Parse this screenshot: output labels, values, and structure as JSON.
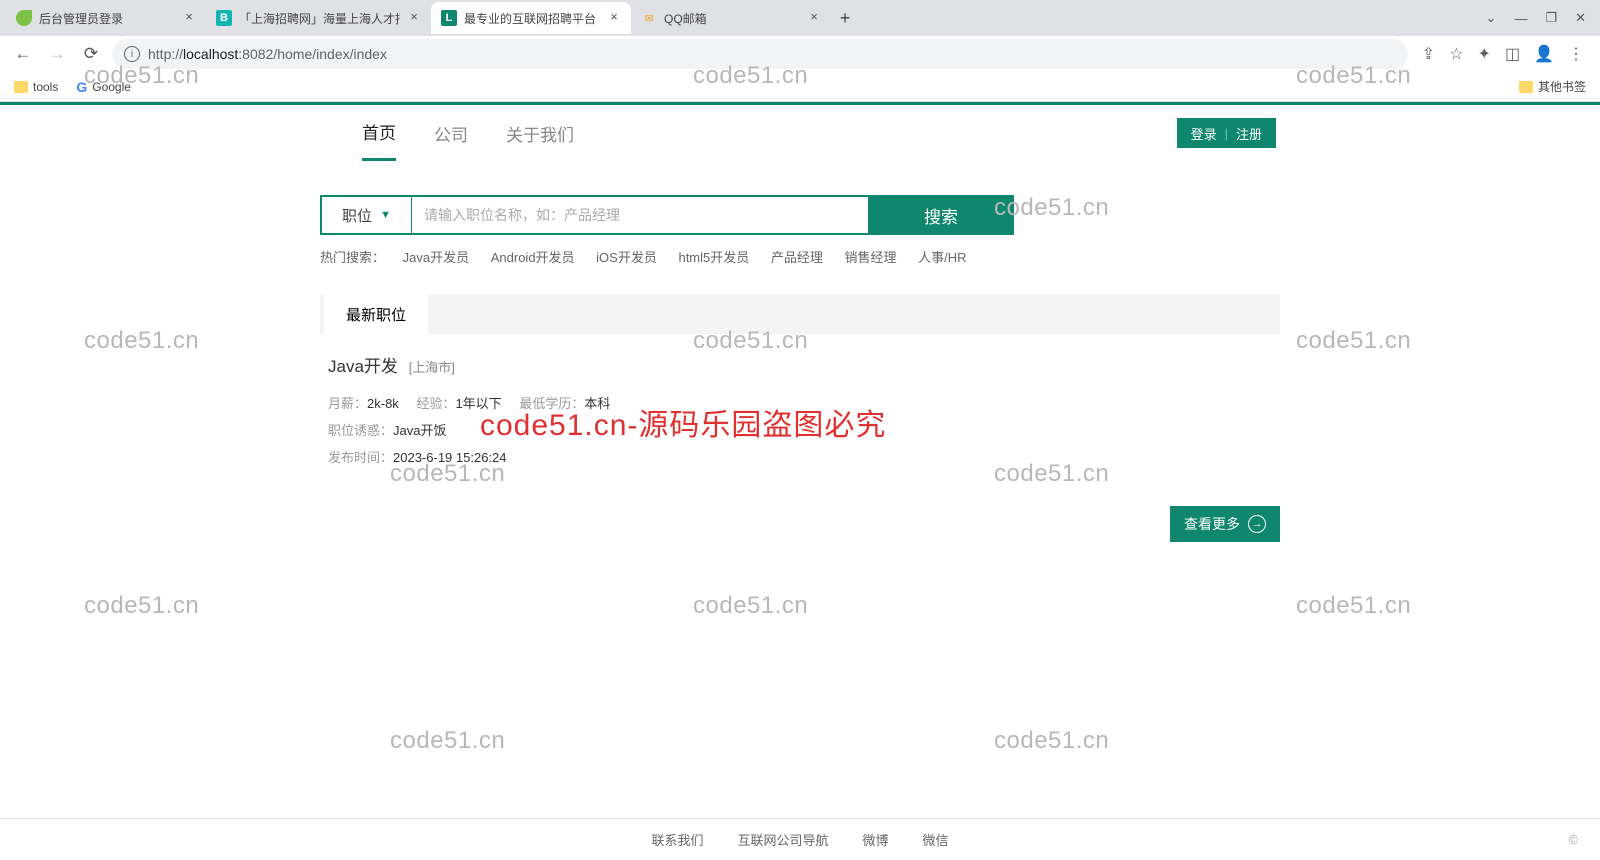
{
  "browser": {
    "tabs": [
      {
        "title": "后台管理员登录",
        "favicon_bg": "#7cc247",
        "favicon_txt": ""
      },
      {
        "title": "「上海招聘网」海量上海人才招聘",
        "favicon_bg": "#13b5b1",
        "favicon_txt": "B"
      },
      {
        "title": "最专业的互联网招聘平台",
        "favicon_bg": "#0f866e",
        "favicon_txt": "L"
      },
      {
        "title": "QQ邮箱",
        "favicon_bg": "transparent",
        "favicon_txt": "✉"
      }
    ],
    "url_host": "localhost",
    "url_prefix": "http://",
    "url_port": ":8082",
    "url_path": "/home/index/index",
    "bookmarks": {
      "tools": "tools",
      "google": "Google",
      "other": "其他书签"
    }
  },
  "nav": {
    "home": "首页",
    "company": "公司",
    "about": "关于我们",
    "login": "登录",
    "register": "注册"
  },
  "search": {
    "select_label": "职位",
    "placeholder": "请输入职位名称，如：产品经理",
    "button": "搜索",
    "hot_label": "热门搜索：",
    "hot_items": [
      "Java开发员",
      "Android开发员",
      "iOS开发员",
      "html5开发员",
      "产品经理",
      "销售经理",
      "人事/HR"
    ]
  },
  "section": {
    "latest": "最新职位"
  },
  "job": {
    "title": "Java开发",
    "location": "[上海市]",
    "salary_label": "月薪：",
    "salary": "2k-8k",
    "exp_label": "经验：",
    "exp": "1年以下",
    "edu_label": "最低学历：",
    "edu": "本科",
    "temptation_label": "职位诱惑：",
    "temptation": "Java开饭",
    "pubtime_label": "发布时间：",
    "pubtime": "2023-6-19 15:26:24"
  },
  "more_button": "查看更多",
  "footer": {
    "contact": "联系我们",
    "nav": "互联网公司导航",
    "weibo": "微博",
    "wechat": "微信",
    "copy": "©"
  },
  "watermark_text": "code51.cn",
  "red_watermark": "code51.cn-源码乐园盗图必究"
}
